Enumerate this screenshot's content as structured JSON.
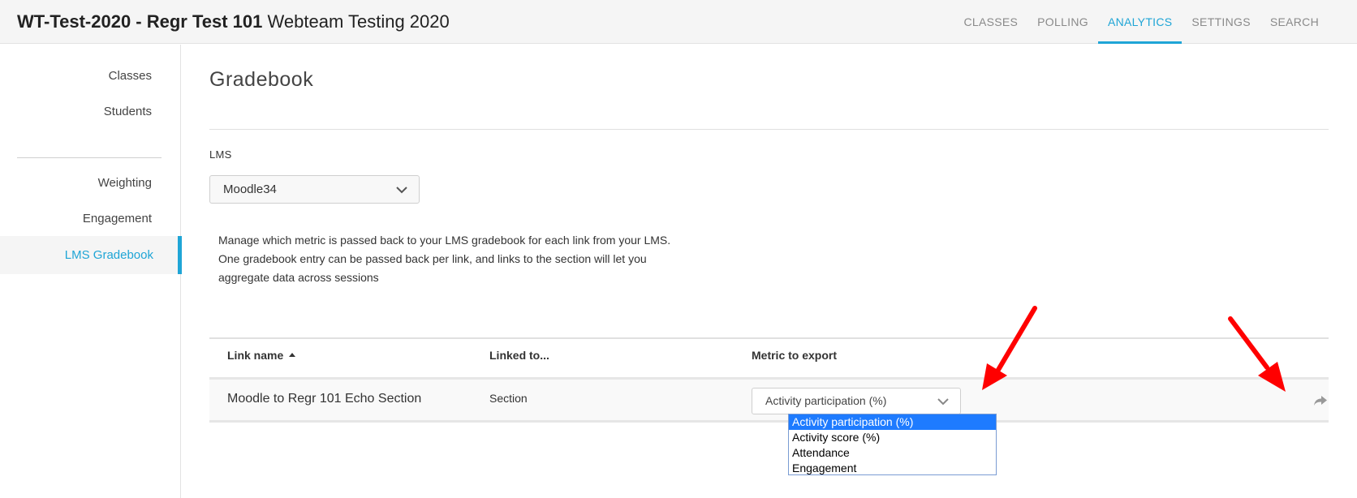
{
  "header": {
    "title_strong": "WT-Test-2020 - Regr Test 101",
    "title_rest": " Webteam Testing 2020",
    "nav": [
      {
        "label": "CLASSES"
      },
      {
        "label": "POLLING"
      },
      {
        "label": "ANALYTICS",
        "active": true
      },
      {
        "label": "SETTINGS"
      },
      {
        "label": "SEARCH"
      }
    ]
  },
  "sidebar": {
    "items": [
      {
        "label": "Classes"
      },
      {
        "label": "Students"
      },
      {
        "label": "Weighting"
      },
      {
        "label": "Engagement"
      },
      {
        "label": "LMS Gradebook",
        "active": true
      }
    ]
  },
  "main": {
    "title": "Gradebook",
    "lms_label": "LMS",
    "lms_value": "Moodle34",
    "description": "Manage which metric is passed back to your LMS gradebook for each link from your LMS. One gradebook entry can be passed back per link, and links to the section will let you aggregate data across sessions"
  },
  "table": {
    "columns": [
      "Link name",
      "Linked to...",
      "Metric to export"
    ],
    "sort_column": "Link name",
    "sort_direction": "ascending",
    "rows": [
      {
        "link_name": "Moodle to Regr 101 Echo Section",
        "linked_to": "Section",
        "metric": "Activity participation (%)"
      }
    ]
  },
  "metric_dropdown": {
    "selected": "Activity participation (%)",
    "options": [
      "Activity participation (%)",
      "Activity score (%)",
      "Attendance",
      "Engagement"
    ]
  },
  "colors": {
    "accent": "#1fa5d6",
    "annotation_arrow": "#ff0000",
    "dropdown_highlight": "#1e7bff"
  },
  "icons": [
    "chevron-down-icon",
    "sort-ascending-icon",
    "share-arrow-icon"
  ]
}
